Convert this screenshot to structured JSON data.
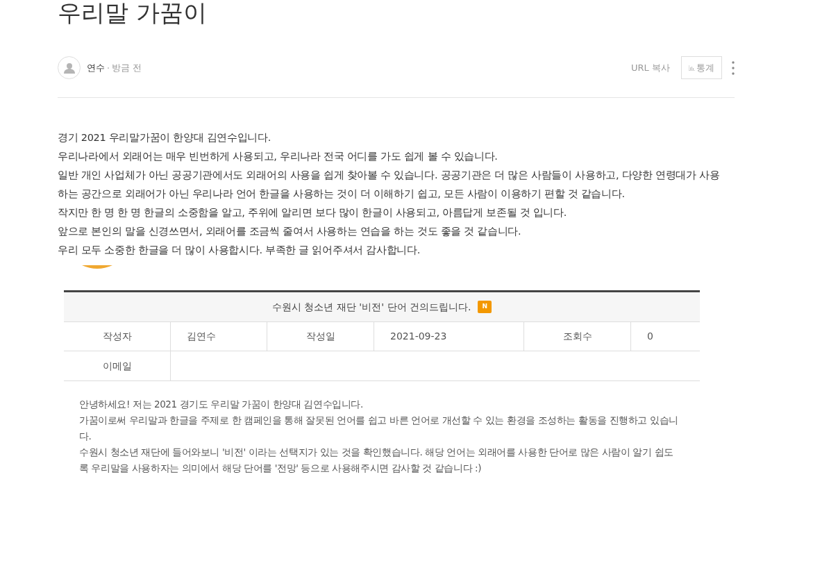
{
  "title": "우리말 가꿈이",
  "author": {
    "name": "연수",
    "time": "방금 전"
  },
  "actions": {
    "copy_url": "URL 복사",
    "stats": "통계"
  },
  "body_lines": [
    "경기 2021 우리말가꿈이 한양대 김연수입니다.",
    "우리나라에서 외래어는 매우 빈번하게 사용되고, 우리나라 전국 어디를 가도 쉽게 볼 수 있습니다.",
    "일반 개인 사업체가 아닌 공공기관에서도 외래어의 사용을 쉽게 찾아볼 수 있습니다. 공공기관은 더 많은 사람들이 사용하고, 다양한 연령대가 사용",
    "하는 공간으로 외래어가 아닌 우리나라 언어 한글을 사용하는 것이 더 이해하기 쉽고, 모든 사람이 이용하기 편할 것 같습니다.",
    "작지만 한 명 한 명 한글의 소중함을 알고, 주위에 알리면 보다 많이 한글이 사용되고, 아름답게 보존될 것 입니다.",
    "앞으로 본인의 말을 신경쓰면서, 외래어를 조금씩 줄여서 사용하는 연습을 하는 것도 좋을 것 같습니다.",
    "우리 모두 소중한 한글을 더 많이 사용합시다. 부족한 글 읽어주셔서 감사합니다."
  ],
  "embedded": {
    "title": "수원시 청소년 재단 '비전' 단어 건의드립니다.",
    "badge": "N",
    "row_1": [
      {
        "label": "작성자",
        "value": "김연수"
      },
      {
        "label": "작성일",
        "value": "2021-09-23"
      },
      {
        "label": "조회수",
        "value": "0"
      }
    ],
    "row_2": {
      "label": "이메일"
    },
    "lines": [
      "안녕하세요! 저는 2021 경기도 우리말 가꿈이 한양대 김연수입니다.",
      "가꿈이로써 우리말과 한글을 주제로 한 캠페인을 통해 잘못된 언어를 쉽고 바른 언어로 개선할 수 있는 환경을 조성하는 활동을 진행하고 있습니",
      "다.",
      "수원시 청소년 재단에 들어와보니 '비전' 이라는 선택지가 있는 것을 확인했습니다. 해당 언어는 외래어를 사용한 단어로 많은 사람이 알기 쉽도",
      "록 우리말을 사용하자는 의미에서 해당 단어를 '전망' 등으로 사용해주시면 감사할 것 같습니다 :)"
    ]
  }
}
